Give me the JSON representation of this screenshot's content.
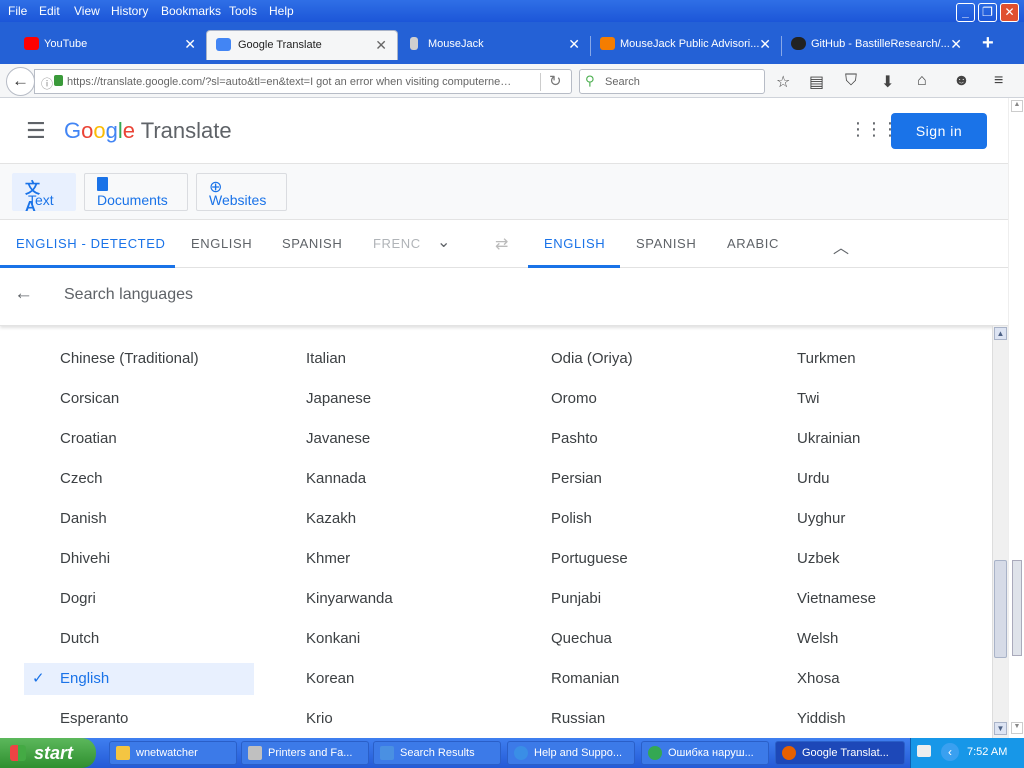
{
  "menubar": {
    "items": [
      "File",
      "Edit",
      "View",
      "History",
      "Bookmarks",
      "Tools",
      "Help"
    ]
  },
  "tabs": [
    {
      "label": "YouTube",
      "icon": "youtube-icon",
      "color": "#ff0000"
    },
    {
      "label": "Google Translate",
      "icon": "google-translate-icon",
      "color": "#4285f4",
      "active": true
    },
    {
      "label": "MouseJack",
      "icon": "mousejack-icon",
      "color": "#777777"
    },
    {
      "label": "MouseJack Public Advisori...",
      "icon": "blogger-icon",
      "color": "#f57d00"
    },
    {
      "label": "GitHub - BastilleResearch/...",
      "icon": "github-icon",
      "color": "#222222"
    }
  ],
  "nav": {
    "url": "https://translate.google.com/?sl=auto&tl=en&text=I got an error when visiting computerne…",
    "search_placeholder": "Search"
  },
  "app": {
    "logo_google": "Google",
    "logo_translate": "Translate",
    "signin": "Sign in",
    "modes": {
      "text": "Text",
      "documents": "Documents",
      "websites": "Websites"
    },
    "source_langs": [
      "ENGLISH - DETECTED",
      "ENGLISH",
      "SPANISH",
      "FRENC"
    ],
    "target_langs": [
      "ENGLISH",
      "SPANISH",
      "ARABIC"
    ],
    "search_placeholder": "Search languages"
  },
  "languages": {
    "col1": [
      "Chinese (Traditional)",
      "Corsican",
      "Croatian",
      "Czech",
      "Danish",
      "Dhivehi",
      "Dogri",
      "Dutch",
      "English",
      "Esperanto"
    ],
    "col2": [
      "Italian",
      "Japanese",
      "Javanese",
      "Kannada",
      "Kazakh",
      "Khmer",
      "Kinyarwanda",
      "Konkani",
      "Korean",
      "Krio"
    ],
    "col3": [
      "Odia (Oriya)",
      "Oromo",
      "Pashto",
      "Persian",
      "Polish",
      "Portuguese",
      "Punjabi",
      "Quechua",
      "Romanian",
      "Russian"
    ],
    "col4": [
      "Turkmen",
      "Twi",
      "Ukrainian",
      "Urdu",
      "Uyghur",
      "Uzbek",
      "Vietnamese",
      "Welsh",
      "Xhosa",
      "Yiddish"
    ],
    "selected": "English"
  },
  "taskbar": {
    "start": "start",
    "tasks": [
      {
        "label": "wnetwatcher",
        "color": "#f4c542"
      },
      {
        "label": "Printers and Fa...",
        "color": "#c0c0c0"
      },
      {
        "label": "Search Results",
        "color": "#4a90e2"
      },
      {
        "label": "Help and Suppo...",
        "color": "#3a8ee6"
      },
      {
        "label": "Ошибка наруш...",
        "color": "#34a853"
      },
      {
        "label": "Google Translat...",
        "color": "#e66000",
        "active": true
      }
    ],
    "clock": "7:52 AM"
  }
}
